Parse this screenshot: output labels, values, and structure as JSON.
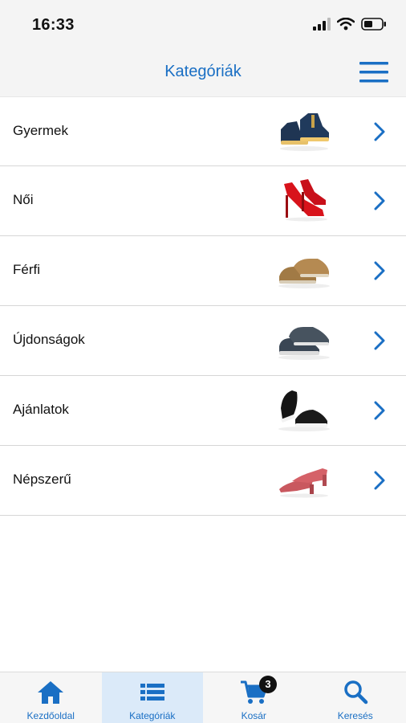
{
  "status_bar": {
    "time": "16:33"
  },
  "nav": {
    "title": "Kategóriák",
    "menu_icon": "hamburger-menu-icon"
  },
  "categories": [
    {
      "label": "Gyermek",
      "image": "kids-sneaker-icon"
    },
    {
      "label": "Női",
      "image": "red-high-heel-icon"
    },
    {
      "label": "Férfi",
      "image": "brown-oxford-shoe-icon"
    },
    {
      "label": "Újdonságok",
      "image": "grey-sneaker-icon"
    },
    {
      "label": "Ajánlatok",
      "image": "black-sneakers-icon"
    },
    {
      "label": "Népszerű",
      "image": "pink-pump-icon"
    }
  ],
  "tabs": [
    {
      "label": "Kezdőoldal",
      "icon": "home-icon"
    },
    {
      "label": "Kategóriák",
      "icon": "list-icon"
    },
    {
      "label": "Kosár",
      "icon": "cart-icon",
      "badge": "3"
    },
    {
      "label": "Keresés",
      "icon": "search-icon"
    }
  ],
  "colors": {
    "accent": "#1a6fc4",
    "active_tab_bg": "#dbeaf9",
    "badge_bg": "#111111"
  }
}
